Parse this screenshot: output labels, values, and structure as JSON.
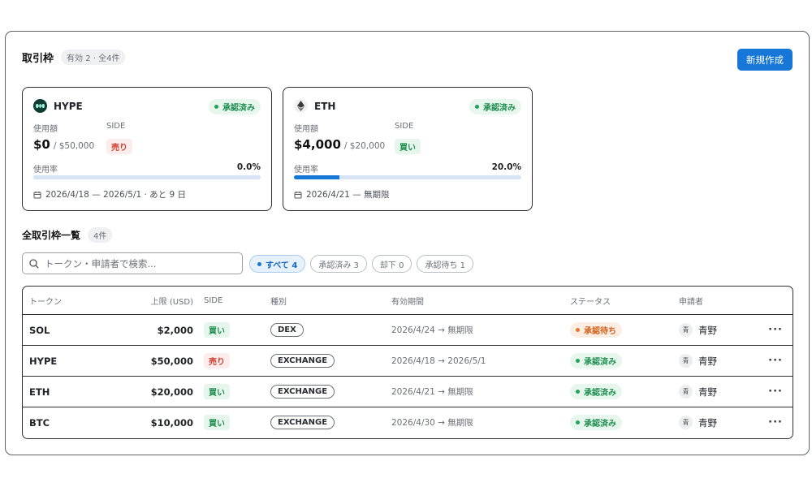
{
  "header": {
    "title": "取引枠",
    "count_badge": "有効 2 · 全4件",
    "new_button": "新規作成"
  },
  "cards": [
    {
      "token": "HYPE",
      "icon": "hype-logo-icon",
      "status": "承認済み",
      "usage_label": "使用額",
      "side_label": "SIDE",
      "used": "$0",
      "limit": "/ $50,000",
      "side": "売り",
      "rate_label": "使用率",
      "rate": "0.0%",
      "rate_fraction": 0.0,
      "period": "2026/4/18 — 2026/5/1 · あと 9 日"
    },
    {
      "token": "ETH",
      "icon": "ethereum-logo-icon",
      "status": "承認済み",
      "usage_label": "使用額",
      "side_label": "SIDE",
      "used": "$4,000",
      "limit": "/ $20,000",
      "side": "買い",
      "rate_label": "使用率",
      "rate": "20.0%",
      "rate_fraction": 0.2,
      "period": "2026/4/21 — 無期限"
    }
  ],
  "list": {
    "title": "全取引枠一覧",
    "count": "4件",
    "search_placeholder": "トークン・申請者で検索...",
    "filters": [
      "すべて 4",
      "承認済み 3",
      "却下 0",
      "承認待ち 1"
    ],
    "active_filter": 0
  },
  "table": {
    "columns": [
      "トークン",
      "上限 (USD)",
      "SIDE",
      "種別",
      "有効期間",
      "ステータス",
      "申請者"
    ],
    "rows": [
      {
        "token": "SOL",
        "limit": "$2,000",
        "side": "買い",
        "type": "DEX",
        "period": "2026/4/24 → 無期限",
        "status": "承認待ち",
        "avatar": "青",
        "user": "青野",
        "more": "···"
      },
      {
        "token": "HYPE",
        "limit": "$50,000",
        "side": "売り",
        "type": "EXCHANGE",
        "period": "2026/4/18 → 2026/5/1",
        "status": "承認済み",
        "avatar": "青",
        "user": "青野",
        "more": "···"
      },
      {
        "token": "ETH",
        "limit": "$20,000",
        "side": "買い",
        "type": "EXCHANGE",
        "period": "2026/4/21 → 無期限",
        "status": "承認済み",
        "avatar": "青",
        "user": "青野",
        "more": "···"
      },
      {
        "token": "BTC",
        "limit": "$10,000",
        "side": "買い",
        "type": "EXCHANGE",
        "period": "2026/4/30 → 無期限",
        "status": "承認済み",
        "avatar": "青",
        "user": "青野",
        "more": "···"
      }
    ]
  },
  "colors": {
    "accent": "#1677d9",
    "approved": "#1e8e4e",
    "pending": "#d2601a",
    "sell": "#d33b2c"
  }
}
